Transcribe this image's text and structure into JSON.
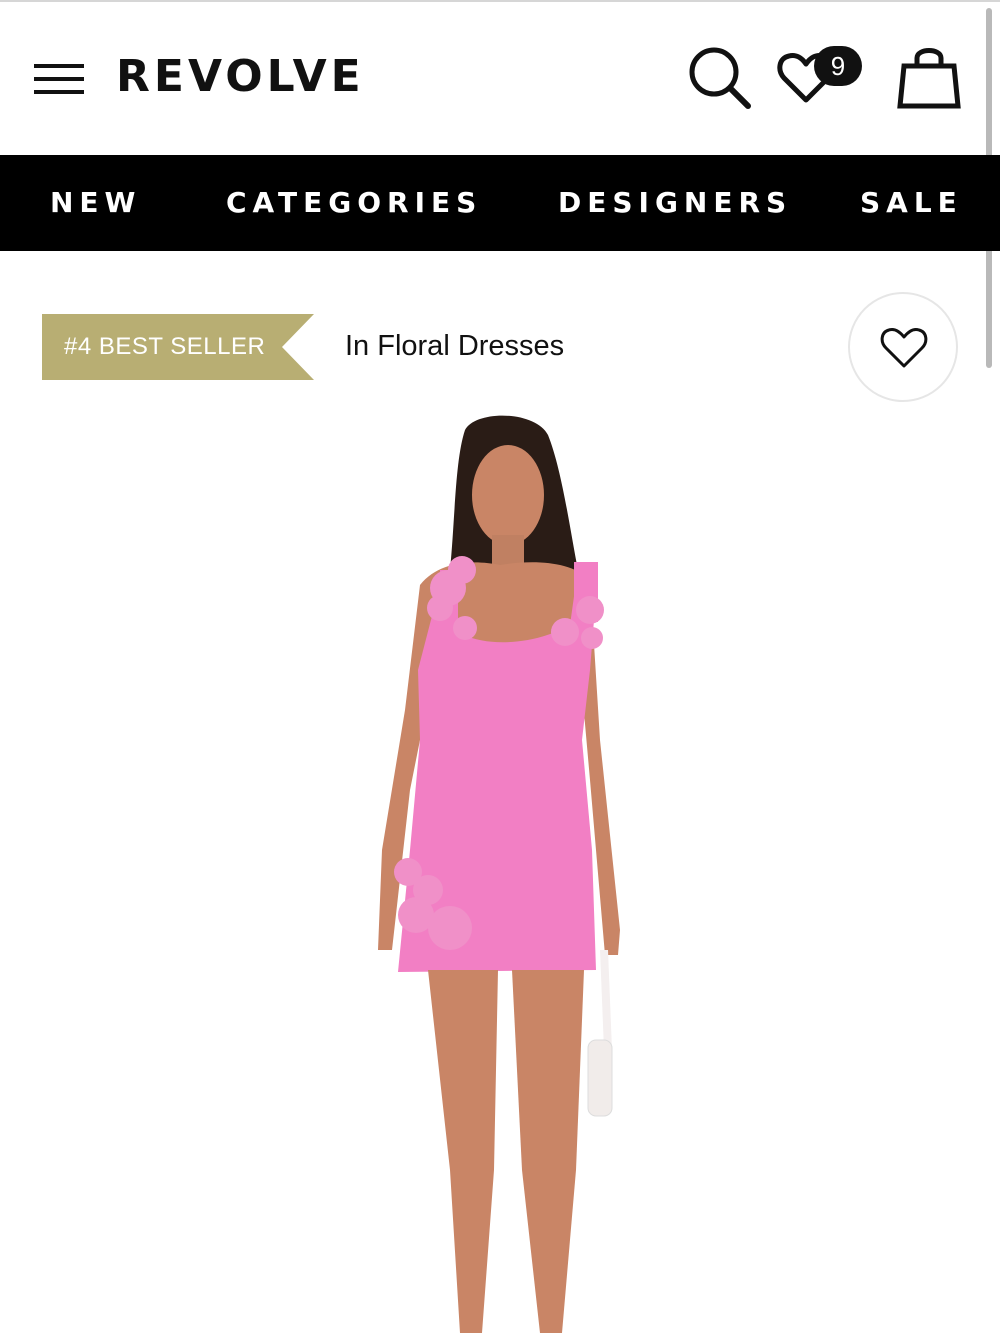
{
  "header": {
    "logo": "REVOLVE",
    "menu_icon": "hamburger-menu-icon",
    "search_icon": "search-icon",
    "wishlist_icon": "heart-icon",
    "wishlist_count": "9",
    "bag_icon": "shopping-bag-icon"
  },
  "nav": {
    "items": [
      {
        "label": "NEW"
      },
      {
        "label": "CATEGORIES"
      },
      {
        "label": "DESIGNERS"
      },
      {
        "label": "SALE"
      }
    ]
  },
  "product": {
    "badge": "#4 BEST SELLER",
    "category": "In Floral Dresses",
    "favorite_icon": "heart-outline-icon",
    "image_description_colors": {
      "dress": "#f27fc4",
      "flowers": "#f090c8",
      "skin": "#c98566",
      "hair": "#2a1c16"
    }
  },
  "colors": {
    "badge_bg": "#b8ae73",
    "nav_bg": "#000000",
    "accent": "#111111"
  }
}
